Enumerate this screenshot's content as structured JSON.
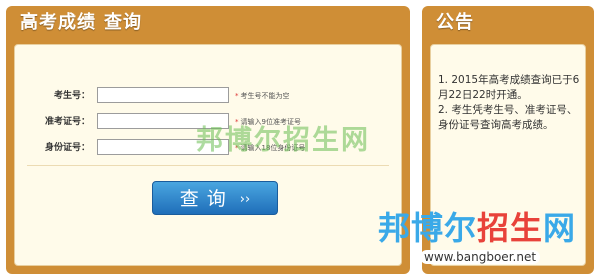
{
  "query_panel": {
    "title_part1": "高考成绩",
    "title_part2": "查询",
    "fields": [
      {
        "label": "考生号：",
        "value": "",
        "hint": "考生号不能为空"
      },
      {
        "label": "准考证号：",
        "value": "",
        "hint": "请输入9位准考证号"
      },
      {
        "label": "身份证号：",
        "value": "",
        "hint": "请输入18位身份证号"
      }
    ],
    "submit_label": "查询",
    "submit_arrow": "››"
  },
  "notice_panel": {
    "title": "公告",
    "items": [
      "1. 2015年高考成绩查询已于6月22日22时开通。",
      "2. 考生凭考生号、准考证号、身份证号查询高考成绩。"
    ]
  },
  "watermark": {
    "overlay_text": "邦博尔招生网",
    "logo_text_a": "邦博尔",
    "logo_text_b": "招生",
    "logo_text_c": "网",
    "url": "www.bangboer.net"
  },
  "colors": {
    "panel_frame": "#cf8e36",
    "panel_body": "#fffbea",
    "button_blue": "#2f86cc",
    "required_star": "#dd3333"
  }
}
